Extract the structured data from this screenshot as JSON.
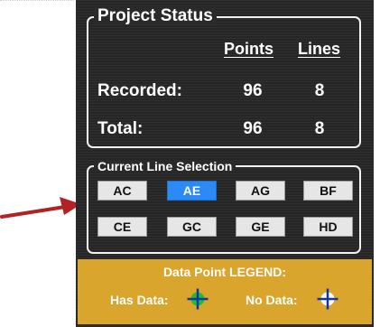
{
  "project_status": {
    "title": "Project Status",
    "columns": [
      "Points",
      "Lines"
    ],
    "rows": [
      {
        "label": "Recorded:",
        "points": "96",
        "lines": "8"
      },
      {
        "label": "Total:",
        "points": "96",
        "lines": "8"
      }
    ]
  },
  "line_selection": {
    "title": "Current Line Selection",
    "selected": "AE",
    "buttons": [
      "AC",
      "AE",
      "AG",
      "BF",
      "CE",
      "GC",
      "GE",
      "HD"
    ]
  },
  "legend": {
    "title": "Data Point LEGEND:",
    "has_data_label": "Has Data:",
    "no_data_label": "No Data:",
    "has_data_icon": "green-crosshair-icon",
    "no_data_icon": "white-crosshair-icon",
    "has_data_color": "#1fbf2e",
    "no_data_color": "#ffffff"
  },
  "colors": {
    "panel_bg": "#262626",
    "selected_button": "#2b8af5",
    "legend_bg": "#d9a52c",
    "arrow": "#b22222"
  }
}
